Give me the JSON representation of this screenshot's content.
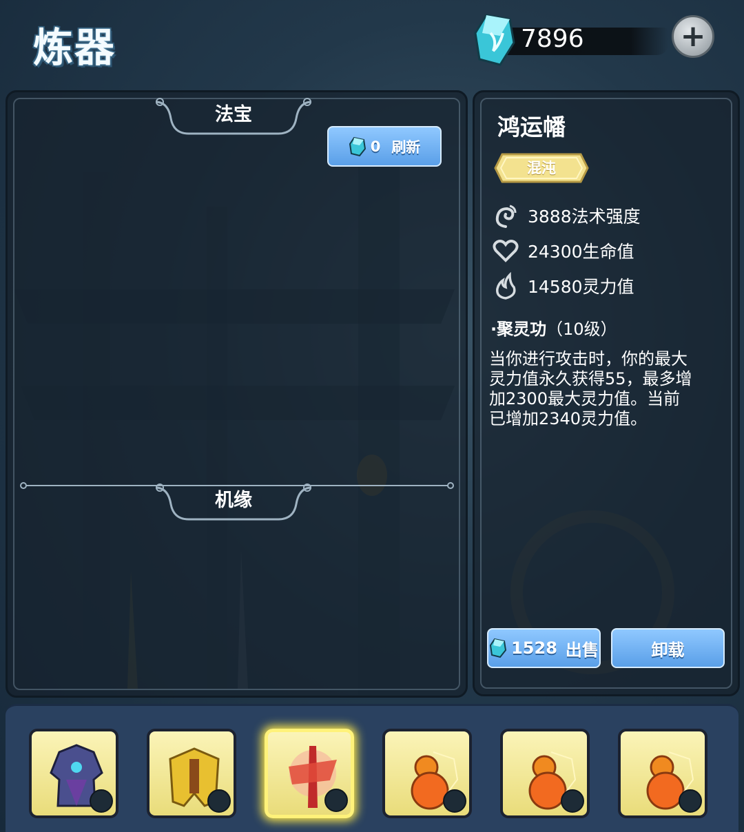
{
  "header": {
    "title": "炼器",
    "currency_amount": "7896",
    "add_icon": "plus-icon"
  },
  "left_panel": {
    "section_top_title": "法宝",
    "refresh": {
      "cost": "0",
      "label": "刷新"
    },
    "section_bottom_title": "机缘"
  },
  "detail": {
    "name": "鸿运幡",
    "rarity": "混沌",
    "stats": [
      {
        "icon": "spell-power-icon",
        "text": "3888法术强度"
      },
      {
        "icon": "heart-icon",
        "text": "24300生命值"
      },
      {
        "icon": "flame-icon",
        "text": "14580灵力值"
      }
    ],
    "skill_name": "·聚灵功",
    "skill_level": "（10级）",
    "skill_desc": "当你进行攻击时，你的最大灵力值永久获得55，最多增加2300最大灵力值。当前已增加2340灵力值。",
    "sell": {
      "price": "1528",
      "label": "出售"
    },
    "unload_label": "卸载"
  },
  "inventory": {
    "selected_index": 2,
    "slots": [
      {
        "icon": "armored-robe-icon"
      },
      {
        "icon": "golden-armor-icon"
      },
      {
        "icon": "red-banner-icon"
      },
      {
        "icon": "gourd-icon"
      },
      {
        "icon": "gourd-icon"
      },
      {
        "icon": "gourd-icon"
      }
    ]
  },
  "colors": {
    "button_blue": "#5a9fe8",
    "slot_yellow": "#f3e99a",
    "rarity_gold": "#f0df8a",
    "crystal_cyan": "#5ee0ee"
  }
}
